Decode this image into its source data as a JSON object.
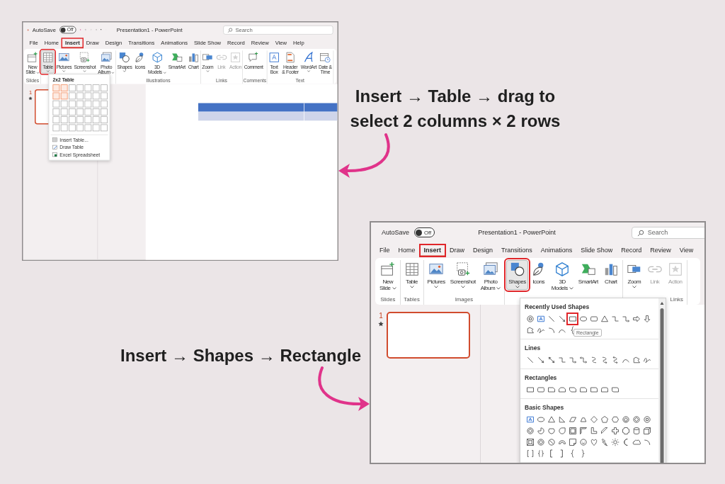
{
  "screenshots": [
    {
      "autosave": "AutoSave",
      "autosave_state": "Off",
      "autosave_on": false,
      "title": "Presentation1 - PowerPoint",
      "search": {
        "placeholder": "Search"
      },
      "tabs": [
        {
          "label": "File",
          "selected": false,
          "highlighted": false
        },
        {
          "label": "Home",
          "selected": false,
          "highlighted": false
        },
        {
          "label": "Insert",
          "selected": true,
          "highlighted": true
        },
        {
          "label": "Draw",
          "selected": false,
          "highlighted": false
        },
        {
          "label": "Design",
          "selected": false,
          "highlighted": false
        },
        {
          "label": "Transitions",
          "selected": false,
          "highlighted": false
        },
        {
          "label": "Animations",
          "selected": false,
          "highlighted": false
        },
        {
          "label": "Slide Show",
          "selected": false,
          "highlighted": false
        },
        {
          "label": "Record",
          "selected": false,
          "highlighted": false
        },
        {
          "label": "Review",
          "selected": false,
          "highlighted": false
        },
        {
          "label": "View",
          "selected": false,
          "highlighted": false
        },
        {
          "label": "Help",
          "selected": false,
          "highlighted": false
        }
      ],
      "ribbon_groups": [
        {
          "label": "Slides",
          "buttons": [
            {
              "kind": "new-slide",
              "label": "New\nSlide",
              "dropdown": true,
              "disabled": false,
              "selected": false,
              "highlighted": false
            }
          ]
        },
        {
          "buttons": [
            {
              "kind": "table",
              "label": "Table",
              "dropdown": true,
              "disabled": false,
              "selected": true,
              "highlighted": true
            }
          ]
        },
        {
          "buttons": [
            {
              "kind": "pictures",
              "label": "Pictures",
              "dropdown": true,
              "disabled": false,
              "selected": false,
              "highlighted": false
            },
            {
              "kind": "screenshot",
              "label": "Screenshot",
              "dropdown": true,
              "disabled": false,
              "selected": false,
              "highlighted": false
            },
            {
              "kind": "photo-album",
              "label": "Photo\nAlbum",
              "dropdown": true,
              "disabled": false,
              "selected": false,
              "highlighted": false
            }
          ]
        },
        {
          "label": "Illustrations",
          "buttons": [
            {
              "kind": "shapes",
              "label": "Shapes",
              "dropdown": true,
              "disabled": false,
              "selected": false,
              "highlighted": false
            },
            {
              "kind": "icons",
              "label": "Icons",
              "dropdown": false,
              "disabled": false,
              "selected": false,
              "highlighted": false
            },
            {
              "kind": "models",
              "label": "3D\nModels",
              "dropdown": true,
              "disabled": false,
              "selected": false,
              "highlighted": false
            },
            {
              "kind": "smartart",
              "label": "SmartArt",
              "dropdown": false,
              "disabled": false,
              "selected": false,
              "highlighted": false
            },
            {
              "kind": "chart",
              "label": "Chart",
              "dropdown": false,
              "disabled": false,
              "selected": false,
              "highlighted": false
            }
          ]
        },
        {
          "label": "Links",
          "buttons": [
            {
              "kind": "zoom",
              "label": "Zoom",
              "dropdown": true,
              "disabled": false,
              "selected": false,
              "highlighted": false
            },
            {
              "kind": "link",
              "label": "Link",
              "dropdown": false,
              "disabled": true,
              "selected": false,
              "highlighted": false
            },
            {
              "kind": "action",
              "label": "Action",
              "dropdown": false,
              "disabled": true,
              "selected": false,
              "highlighted": false
            }
          ]
        },
        {
          "label": "Comments",
          "buttons": [
            {
              "kind": "comment",
              "label": "Comment",
              "dropdown": false,
              "disabled": false,
              "selected": false,
              "highlighted": false
            }
          ]
        },
        {
          "label": "Text",
          "buttons": [
            {
              "kind": "textbox",
              "label": "Text\nBox",
              "dropdown": false,
              "disabled": false,
              "selected": false,
              "highlighted": false
            },
            {
              "kind": "header-footer",
              "label": "Header\n& Footer",
              "dropdown": false,
              "disabled": false,
              "selected": false,
              "highlighted": false
            },
            {
              "kind": "wordart",
              "label": "WordArt",
              "dropdown": true,
              "disabled": false,
              "selected": false,
              "highlighted": false
            },
            {
              "kind": "date-time",
              "label": "Date &\nTime",
              "dropdown": false,
              "disabled": false,
              "selected": false,
              "highlighted": false
            }
          ]
        }
      ],
      "slide_panel": {
        "number": "1",
        "selected": true
      },
      "slide_table": {
        "rows": [
          {
            "kind": "header",
            "cells": [
              {
                "kind": "empty"
              },
              {
                "kind": "empty"
              }
            ]
          },
          {
            "kind": "band",
            "cells": [
              {
                "kind": "empty"
              },
              {
                "kind": "empty"
              }
            ]
          }
        ]
      },
      "dropdown": {
        "kind": "table-grid",
        "title": "2x2 Table",
        "grid_rows": [
          {
            "cells": [
              {
                "selected": true
              },
              {
                "selected": true
              },
              {
                "selected": false
              },
              {
                "selected": false
              },
              {
                "selected": false
              },
              {
                "selected": false
              },
              {
                "selected": false
              }
            ]
          },
          {
            "cells": [
              {
                "selected": true
              },
              {
                "selected": true
              },
              {
                "selected": false
              },
              {
                "selected": false
              },
              {
                "selected": false
              },
              {
                "selected": false
              },
              {
                "selected": false
              }
            ]
          },
          {
            "cells": [
              {
                "selected": false
              },
              {
                "selected": false
              },
              {
                "selected": false
              },
              {
                "selected": false
              },
              {
                "selected": false
              },
              {
                "selected": false
              },
              {
                "selected": false
              }
            ]
          },
          {
            "cells": [
              {
                "selected": false
              },
              {
                "selected": false
              },
              {
                "selected": false
              },
              {
                "selected": false
              },
              {
                "selected": false
              },
              {
                "selected": false
              },
              {
                "selected": false
              }
            ]
          },
          {
            "cells": [
              {
                "selected": false
              },
              {
                "selected": false
              },
              {
                "selected": false
              },
              {
                "selected": false
              },
              {
                "selected": false
              },
              {
                "selected": false
              },
              {
                "selected": false
              }
            ]
          },
          {
            "cells": [
              {
                "selected": false
              },
              {
                "selected": false
              },
              {
                "selected": false
              },
              {
                "selected": false
              },
              {
                "selected": false
              },
              {
                "selected": false
              },
              {
                "selected": false
              }
            ]
          }
        ],
        "items": [
          {
            "kind": "insert-table",
            "label": "Insert Table..."
          },
          {
            "kind": "draw-table",
            "label": "Draw Table"
          },
          {
            "kind": "excel",
            "label": "Excel Spreadsheet"
          }
        ]
      }
    },
    {
      "autosave": "AutoSave",
      "autosave_state": "Off",
      "autosave_on": false,
      "title": "Presentation1 - PowerPoint",
      "search": {
        "placeholder": "Search"
      },
      "tabs": [
        {
          "label": "File",
          "selected": false,
          "highlighted": false
        },
        {
          "label": "Home",
          "selected": false,
          "highlighted": false
        },
        {
          "label": "Insert",
          "selected": true,
          "highlighted": true
        },
        {
          "label": "Draw",
          "selected": false,
          "highlighted": false
        },
        {
          "label": "Design",
          "selected": false,
          "highlighted": false
        },
        {
          "label": "Transitions",
          "selected": false,
          "highlighted": false
        },
        {
          "label": "Animations",
          "selected": false,
          "highlighted": false
        },
        {
          "label": "Slide Show",
          "selected": false,
          "highlighted": false
        },
        {
          "label": "Record",
          "selected": false,
          "highlighted": false
        },
        {
          "label": "Review",
          "selected": false,
          "highlighted": false
        },
        {
          "label": "View",
          "selected": false,
          "highlighted": false
        }
      ],
      "ribbon_groups": [
        {
          "label": "Slides",
          "buttons": [
            {
              "kind": "new-slide",
              "label": "New\nSlide",
              "dropdown": true,
              "disabled": false,
              "selected": false,
              "highlighted": false
            }
          ]
        },
        {
          "label": "Tables",
          "buttons": [
            {
              "kind": "table",
              "label": "Table",
              "dropdown": true,
              "disabled": false,
              "selected": false,
              "highlighted": false
            }
          ]
        },
        {
          "label": "Images",
          "buttons": [
            {
              "kind": "pictures",
              "label": "Pictures",
              "dropdown": true,
              "disabled": false,
              "selected": false,
              "highlighted": false
            },
            {
              "kind": "screenshot",
              "label": "Screenshot",
              "dropdown": true,
              "disabled": false,
              "selected": false,
              "highlighted": false
            },
            {
              "kind": "photo-album",
              "label": "Photo\nAlbum",
              "dropdown": true,
              "disabled": false,
              "selected": false,
              "highlighted": false
            }
          ]
        },
        {
          "buttons": [
            {
              "kind": "shapes",
              "label": "Shapes",
              "dropdown": true,
              "disabled": false,
              "selected": true,
              "highlighted": true
            },
            {
              "kind": "icons",
              "label": "Icons",
              "dropdown": false,
              "disabled": false,
              "selected": false,
              "highlighted": false
            },
            {
              "kind": "models",
              "label": "3D\nModels",
              "dropdown": true,
              "disabled": false,
              "selected": false,
              "highlighted": false
            },
            {
              "kind": "smartart",
              "label": "SmartArt",
              "dropdown": false,
              "disabled": false,
              "selected": false,
              "highlighted": false
            },
            {
              "kind": "chart",
              "label": "Chart",
              "dropdown": false,
              "disabled": false,
              "selected": false,
              "highlighted": false
            }
          ]
        },
        {
          "label": "Links",
          "buttons": [
            {
              "kind": "zoom",
              "label": "Zoom",
              "dropdown": true,
              "disabled": false,
              "selected": false,
              "highlighted": false
            },
            {
              "kind": "link",
              "label": "Link",
              "dropdown": false,
              "disabled": true,
              "selected": false,
              "highlighted": false
            },
            {
              "kind": "action",
              "label": "Action",
              "dropdown": false,
              "disabled": true,
              "selected": false,
              "highlighted": false
            }
          ]
        }
      ],
      "slide_panel": {
        "number": "1",
        "selected": true
      },
      "dropdown": {
        "kind": "shape-gallery",
        "tooltip": "Rectangle",
        "sections": [
          {
            "title": "Recently Used Shapes",
            "shapes": [
              {
                "kind": "decagon",
                "selected": false
              },
              {
                "kind": "textbox",
                "selected": false
              },
              {
                "kind": "line",
                "selected": false
              },
              {
                "kind": "arrow-line",
                "selected": false
              },
              {
                "kind": "rect",
                "selected": true
              },
              {
                "kind": "oval",
                "selected": false
              },
              {
                "kind": "rounded",
                "selected": false
              },
              {
                "kind": "triangle",
                "selected": false
              },
              {
                "kind": "elbow",
                "selected": false
              },
              {
                "kind": "elbow-arrow",
                "selected": false
              },
              {
                "kind": "arrow-right",
                "selected": false
              },
              {
                "kind": "arrow-down",
                "selected": false
              },
              {
                "kind": "freeform",
                "selected": false
              },
              {
                "kind": "scribble",
                "selected": false
              },
              {
                "kind": "arc",
                "selected": false
              },
              {
                "kind": "curve",
                "selected": false
              },
              {
                "kind": "left-brace",
                "selected": false
              }
            ]
          },
          {
            "title": "Lines",
            "shapes": [
              {
                "kind": "line",
                "selected": false
              },
              {
                "kind": "arrow-line",
                "selected": false
              },
              {
                "kind": "double-arrow",
                "selected": false
              },
              {
                "kind": "elbow",
                "selected": false
              },
              {
                "kind": "elbow-arrow",
                "selected": false
              },
              {
                "kind": "elbow-double",
                "selected": false
              },
              {
                "kind": "curve-s",
                "selected": false
              },
              {
                "kind": "curve-s-arrow",
                "selected": false
              },
              {
                "kind": "curve-s-double",
                "selected": false
              },
              {
                "kind": "curve",
                "selected": false
              },
              {
                "kind": "freeform",
                "selected": false
              },
              {
                "kind": "scribble",
                "selected": false
              }
            ]
          },
          {
            "title": "Rectangles",
            "shapes": [
              {
                "kind": "rect",
                "selected": false
              },
              {
                "kind": "rounded",
                "selected": false
              },
              {
                "kind": "snip-corner",
                "selected": false
              },
              {
                "kind": "snip-same",
                "selected": false
              },
              {
                "kind": "snip-diagonal",
                "selected": false
              },
              {
                "kind": "snip-round",
                "selected": false
              },
              {
                "kind": "round-corner",
                "selected": false
              },
              {
                "kind": "round-same",
                "selected": false
              },
              {
                "kind": "round-diagonal",
                "selected": false
              }
            ]
          },
          {
            "title": "Basic Shapes",
            "shapes": [
              {
                "kind": "textbox",
                "selected": false
              },
              {
                "kind": "oval",
                "selected": false
              },
              {
                "kind": "triangle",
                "selected": false
              },
              {
                "kind": "right-triangle",
                "selected": false
              },
              {
                "kind": "parallelogram",
                "selected": false
              },
              {
                "kind": "trapezoid",
                "selected": false
              },
              {
                "kind": "diamond",
                "selected": false
              },
              {
                "kind": "pentagon",
                "selected": false
              },
              {
                "kind": "hexagon",
                "selected": false
              },
              {
                "kind": "heptagon",
                "selected": false
              },
              {
                "kind": "octagon",
                "selected": false
              },
              {
                "kind": "decagon",
                "selected": false
              },
              {
                "kind": "dodecagon",
                "selected": false
              },
              {
                "kind": "pie",
                "selected": false
              },
              {
                "kind": "chord",
                "selected": false
              },
              {
                "kind": "teardrop",
                "selected": false
              },
              {
                "kind": "frame",
                "selected": false
              },
              {
                "kind": "half-frame",
                "selected": false
              },
              {
                "kind": "l-shape",
                "selected": false
              },
              {
                "kind": "diagonal-stripe",
                "selected": false
              },
              {
                "kind": "cross",
                "selected": false
              },
              {
                "kind": "plaque",
                "selected": false
              },
              {
                "kind": "can",
                "selected": false
              },
              {
                "kind": "cube",
                "selected": false
              },
              {
                "kind": "bevel",
                "selected": false
              },
              {
                "kind": "donut",
                "selected": false
              },
              {
                "kind": "no-symbol",
                "selected": false
              },
              {
                "kind": "block-arc",
                "selected": false
              },
              {
                "kind": "folded-corner",
                "selected": false
              },
              {
                "kind": "smiley",
                "selected": false
              },
              {
                "kind": "heart",
                "selected": false
              },
              {
                "kind": "lightning",
                "selected": false
              },
              {
                "kind": "sun",
                "selected": false
              },
              {
                "kind": "moon",
                "selected": false
              },
              {
                "kind": "cloud",
                "selected": false
              },
              {
                "kind": "arc",
                "selected": false
              },
              {
                "kind": "bracket-pair",
                "selected": false
              },
              {
                "kind": "brace-pair",
                "selected": false
              },
              {
                "kind": "left-bracket",
                "selected": false
              },
              {
                "kind": "right-bracket",
                "selected": false
              },
              {
                "kind": "left-brace",
                "selected": false
              },
              {
                "kind": "right-brace",
                "selected": false
              }
            ]
          }
        ]
      }
    }
  ],
  "captions": [
    {
      "text": "Insert → Table → drag to select 2 columns × 2 rows"
    },
    {
      "text": "Insert → Shapes → Rectangle"
    }
  ]
}
